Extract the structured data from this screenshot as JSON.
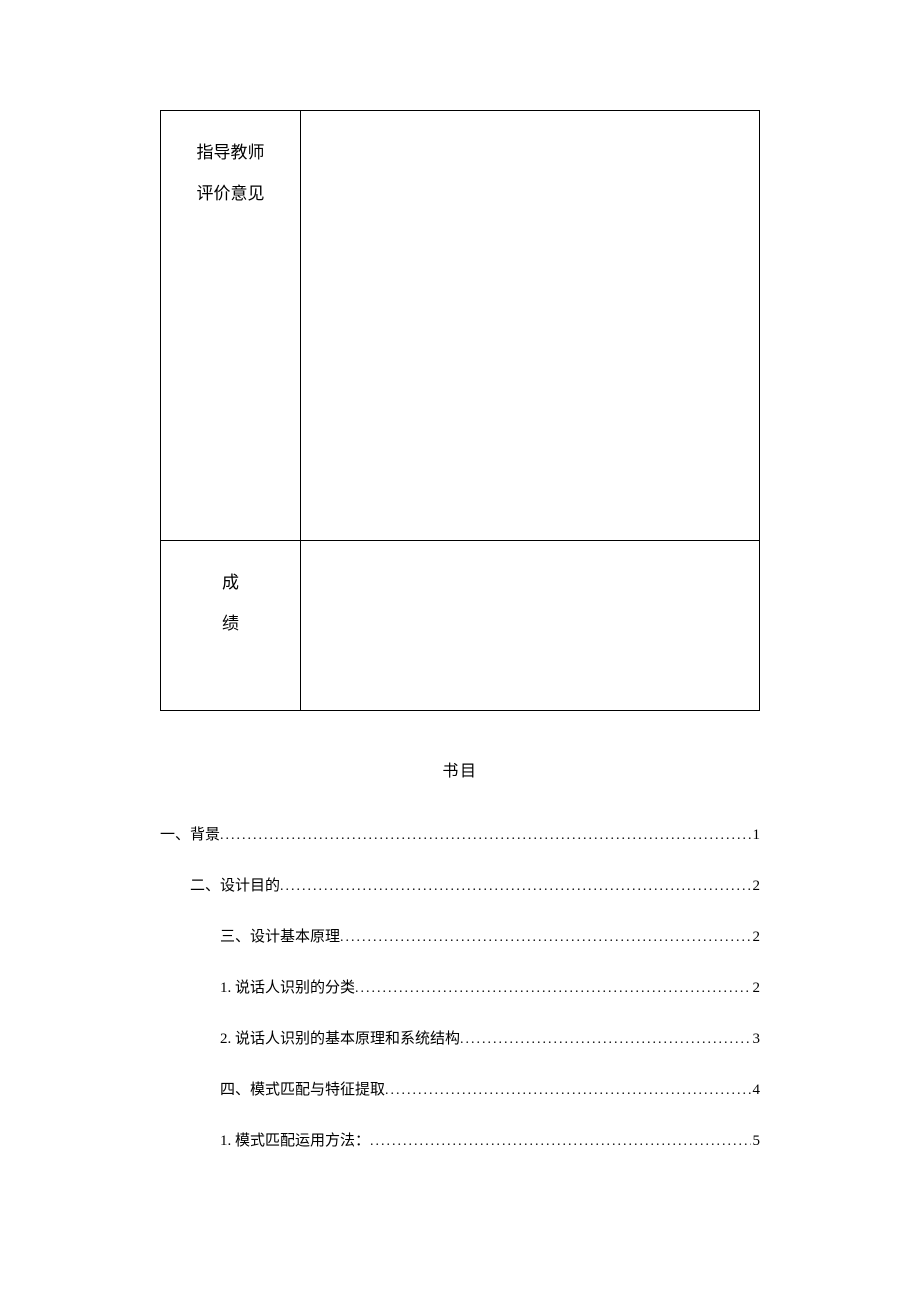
{
  "form": {
    "row1_label_line1": "指导教师",
    "row1_label_line2": "评价意见",
    "row1_value": "",
    "row2_label_line1": "成",
    "row2_label_line2": "绩",
    "row2_value": ""
  },
  "toc_title": "书目",
  "toc": [
    {
      "label": "一、背景",
      "page": "1",
      "indent": 0
    },
    {
      "label": "二、设计目的",
      "page": "2",
      "indent": 1
    },
    {
      "label": "三、设计基本原理",
      "page": "2",
      "indent": 2
    },
    {
      "label": "1. 说话人识别的分类",
      "page": "2",
      "indent": 2
    },
    {
      "label": "2. 说话人识别的基本原理和系统结构",
      "page": "3",
      "indent": 2
    },
    {
      "label": "四、模式匹配与特征提取",
      "page": "4",
      "indent": 2
    },
    {
      "label": "1. 模式匹配运用方法：",
      "page": "5",
      "indent": 2
    }
  ]
}
